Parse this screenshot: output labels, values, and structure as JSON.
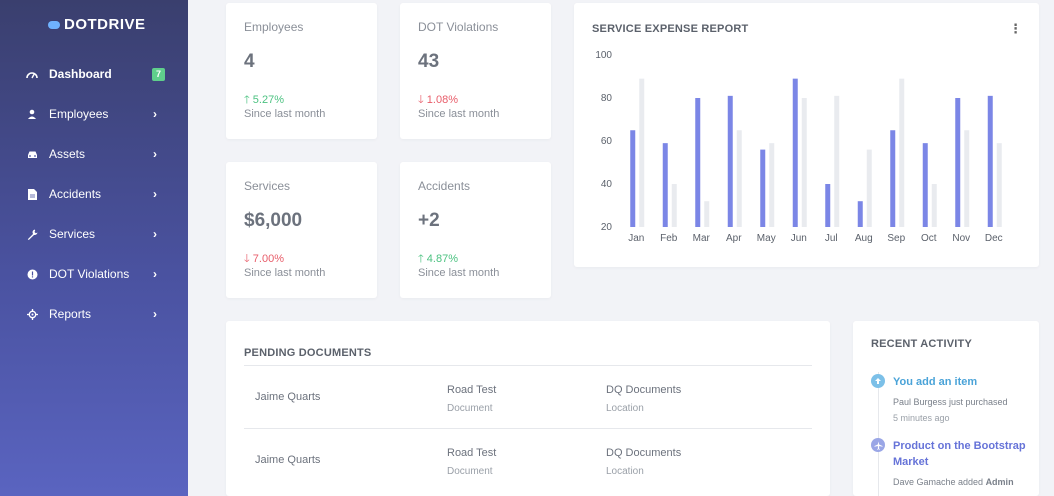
{
  "brand": {
    "name": "DOTDRIVE"
  },
  "sidebar": {
    "items": [
      {
        "label": "Dashboard",
        "icon": "gauge-icon",
        "badge": "7"
      },
      {
        "label": "Employees",
        "icon": "user-icon"
      },
      {
        "label": "Assets",
        "icon": "car-icon"
      },
      {
        "label": "Accidents",
        "icon": "file-icon"
      },
      {
        "label": "Services",
        "icon": "wrench-icon"
      },
      {
        "label": "DOT Violations",
        "icon": "alert-icon"
      },
      {
        "label": "Reports",
        "icon": "gear-icon"
      }
    ]
  },
  "stats": [
    {
      "title": "Employees",
      "value": "4",
      "change": "5.27%",
      "direction": "up",
      "since": "Since last month"
    },
    {
      "title": "DOT Violations",
      "value": "43",
      "change": "1.08%",
      "direction": "down",
      "since": "Since last month"
    },
    {
      "title": "Services",
      "value": "$6,000",
      "change": "7.00%",
      "direction": "down",
      "since": "Since last month"
    },
    {
      "title": "Accidents",
      "value": "+2",
      "change": "4.87%",
      "direction": "up",
      "since": "Since last month"
    }
  ],
  "expense_report": {
    "title": "SERVICE EXPENSE REPORT",
    "menu_glyph": "⋮"
  },
  "chart_data": {
    "type": "bar",
    "title": "SERVICE EXPENSE REPORT",
    "categories": [
      "Jan",
      "Feb",
      "Mar",
      "Apr",
      "May",
      "Jun",
      "Jul",
      "Aug",
      "Sep",
      "Oct",
      "Nov",
      "Dec"
    ],
    "series": [
      {
        "values": [
          65,
          59,
          80,
          81,
          56,
          89,
          40,
          32,
          65,
          59,
          80,
          81
        ],
        "color": "#7b86e6"
      },
      {
        "values": [
          89,
          40,
          32,
          65,
          59,
          80,
          81,
          56,
          89,
          40,
          65,
          59
        ],
        "color": "#e9ebef"
      }
    ],
    "ylim": [
      20,
      100
    ],
    "yticks": [
      20,
      40,
      60,
      80,
      100
    ],
    "grid": false,
    "xlabel": "",
    "ylabel": ""
  },
  "pending_documents": {
    "title": "PENDING DOCUMENTS",
    "rows": [
      {
        "name": "Jaime Quarts",
        "document": "Road Test",
        "document_sub": "Document",
        "location": "DQ Documents",
        "location_sub": "Location"
      },
      {
        "name": "Jaime Quarts",
        "document": "Road Test",
        "document_sub": "Document",
        "location": "DQ Documents",
        "location_sub": "Location"
      }
    ]
  },
  "recent_activity": {
    "title": "RECENT ACTIVITY",
    "items": [
      {
        "title": "You add an item",
        "text": "Paul Burgess just purchased",
        "time": "5 minutes ago",
        "color": "#7cc0e8"
      },
      {
        "title_line1": "Product on the Bootstrap",
        "title_line2": "Market",
        "text_prefix": "Dave Gamache added ",
        "text_bold": "Admin",
        "color": "#9aa6e6"
      }
    ]
  },
  "colors": {
    "up": "#4cc281",
    "down": "#e85d6a",
    "accent": "#7b86e6"
  }
}
